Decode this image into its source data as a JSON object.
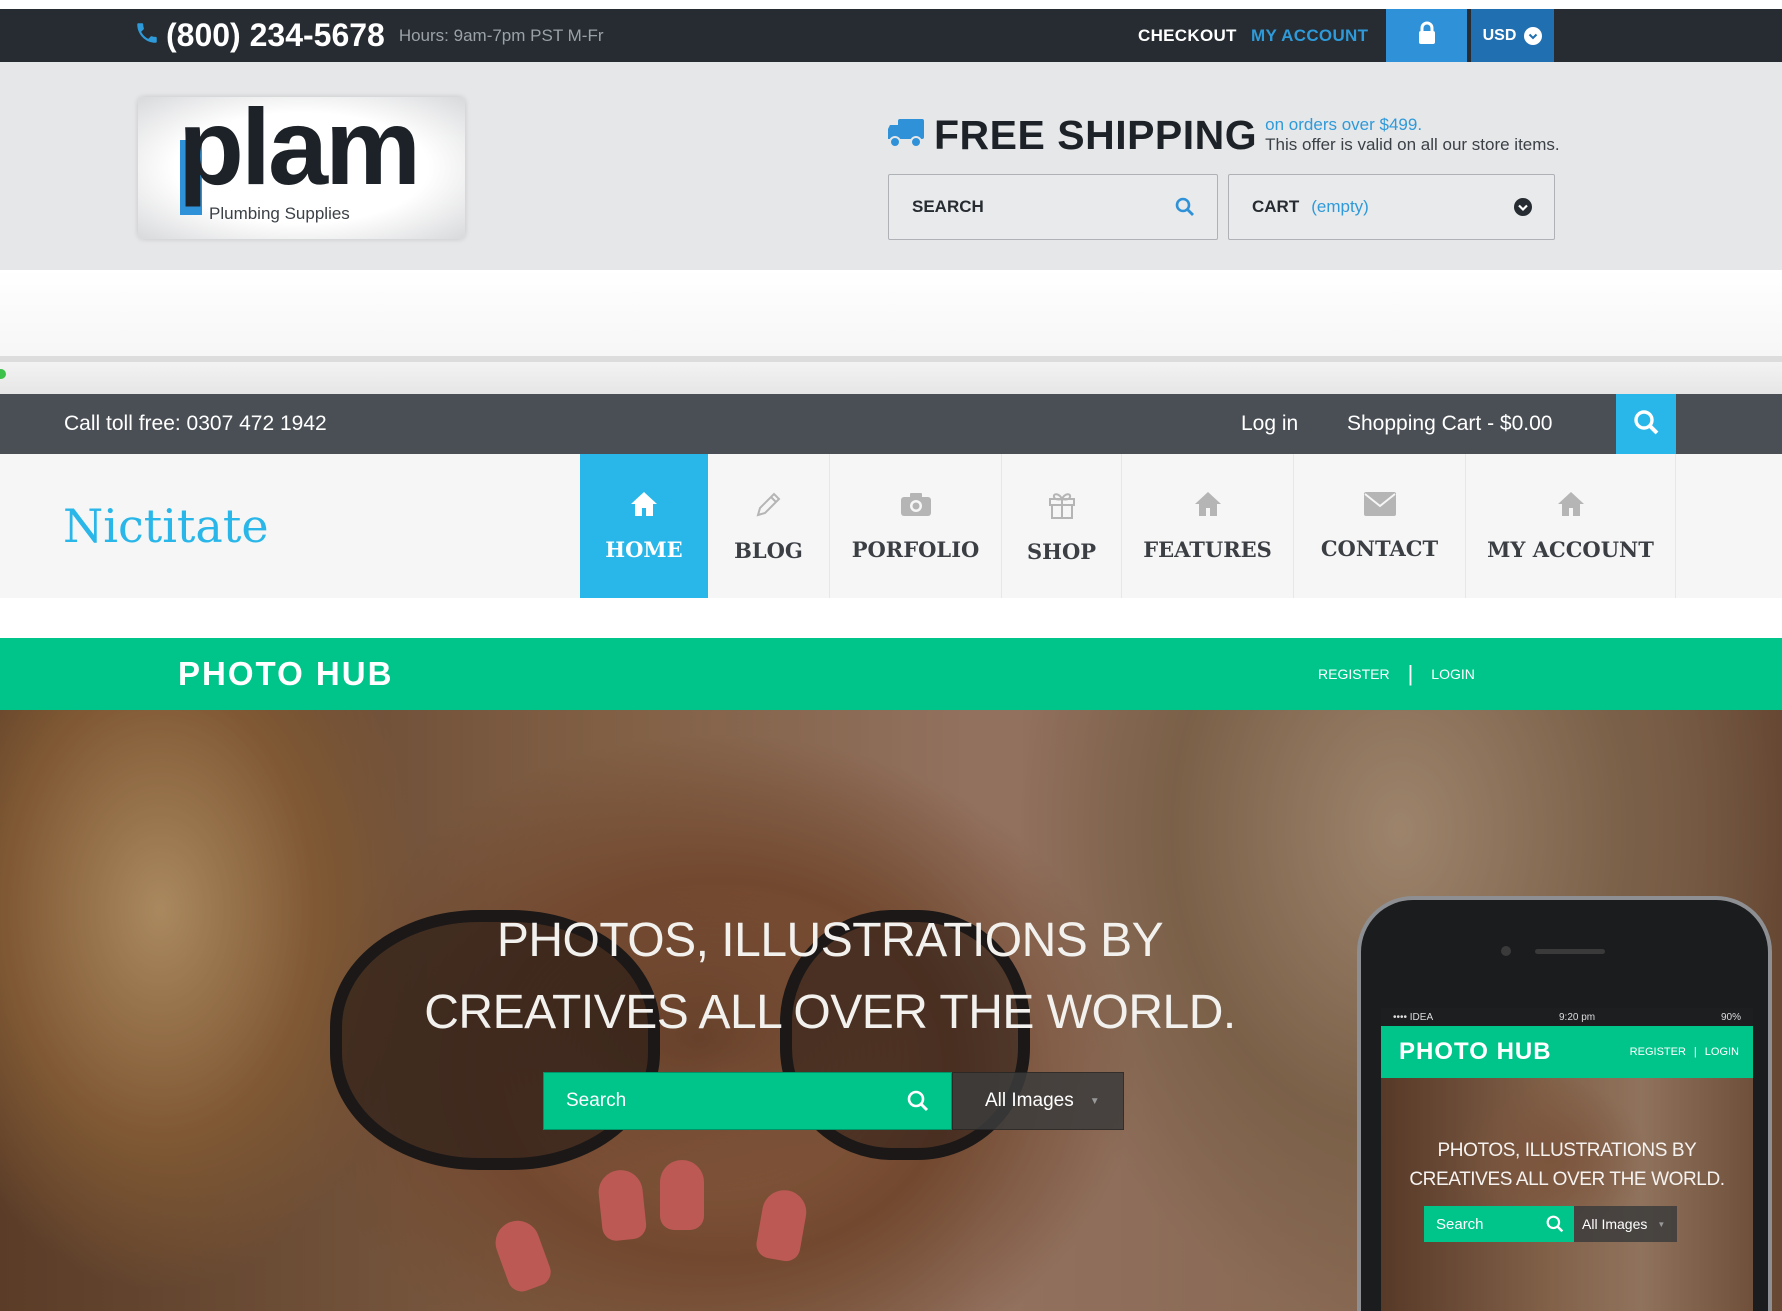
{
  "plam": {
    "phone": "(800) 234-5678",
    "hours": "Hours: 9am-7pm PST M-Fr",
    "checkout": "CHECKOUT",
    "my_account": "MY ACCOUNT",
    "currency": "USD",
    "logo_word": "plam",
    "logo_sub": "Plumbing Supplies",
    "shipping_title": "FREE SHIPPING",
    "shipping_line1": "on orders over $499.",
    "shipping_line2": "This offer is valid on all our store items.",
    "search_label": "SEARCH",
    "cart_label": "CART",
    "cart_state": "(empty)",
    "colors": {
      "topbar": "#262c31",
      "accent": "#2f92d8",
      "header_bg": "#e6e7e9"
    }
  },
  "nictitate": {
    "toll_free": "Call toll free: 0307 472 1942",
    "login": "Log in",
    "cart": "Shopping Cart - $0.00",
    "brand": "Nictitate",
    "nav": [
      {
        "label": "HOME",
        "icon": "home-icon",
        "active": true
      },
      {
        "label": "BLOG",
        "icon": "pencil-icon",
        "active": false
      },
      {
        "label": "PORFOLIO",
        "icon": "camera-icon",
        "active": false
      },
      {
        "label": "SHOP",
        "icon": "gift-icon",
        "active": false
      },
      {
        "label": "FEATURES",
        "icon": "home-icon",
        "active": false
      },
      {
        "label": "CONTACT",
        "icon": "envelope-icon",
        "active": false
      },
      {
        "label": "MY ACCOUNT",
        "icon": "home-icon",
        "active": false
      }
    ],
    "colors": {
      "accent": "#29b6e8",
      "topbar": "#4a4f55"
    }
  },
  "photohub": {
    "logo": "PHOTO HUB",
    "register": "REGISTER",
    "login": "LOGIN",
    "separator": "|",
    "headline_line1": "PHOTOS, ILLUSTRATIONS BY",
    "headline_line2": "CREATIVES ALL OVER THE WORLD.",
    "search_placeholder": "Search",
    "filter": "All Images",
    "phone": {
      "status_left": "•••• IDEA",
      "status_time": "9:20 pm",
      "status_right": "90%",
      "logo": "PHOTO HUB",
      "register": "REGISTER",
      "login": "LOGIN",
      "headline_line1": "PHOTOS, ILLUSTRATIONS BY",
      "headline_line2": "CREATIVES ALL OVER THE WORLD.",
      "search_placeholder": "Search",
      "filter": "All Images"
    },
    "colors": {
      "accent": "#00c58a"
    }
  }
}
